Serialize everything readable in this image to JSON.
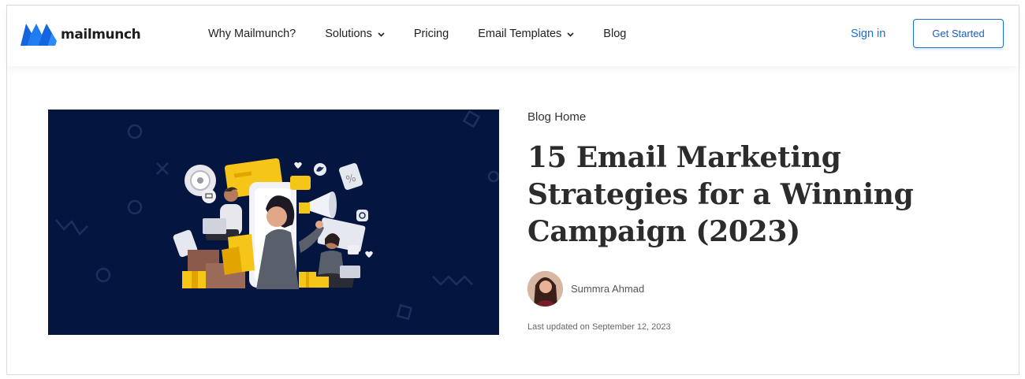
{
  "brand": {
    "name": "mailmunch",
    "color": "#1a6fd6"
  },
  "nav": {
    "items": [
      {
        "label": "Why Mailmunch?",
        "dropdown": false
      },
      {
        "label": "Solutions",
        "dropdown": true
      },
      {
        "label": "Pricing",
        "dropdown": false
      },
      {
        "label": "Email Templates",
        "dropdown": true
      },
      {
        "label": "Blog",
        "dropdown": false
      }
    ],
    "sign_in": "Sign in",
    "cta": "Get Started"
  },
  "hero": {
    "background": "#04163f",
    "icons": [
      "bullseye-icon",
      "twitter-icon",
      "instagram-icon",
      "megaphone-icon",
      "shopping-cart-icon",
      "percent-tag-icon",
      "heart-icon",
      "gift-box-icon"
    ]
  },
  "article": {
    "breadcrumb": "Blog Home",
    "title": "15 Email Marketing Strategies for a Winning Campaign (2023)",
    "author": "Summra Ahmad",
    "updated": "Last updated on September 12, 2023"
  }
}
